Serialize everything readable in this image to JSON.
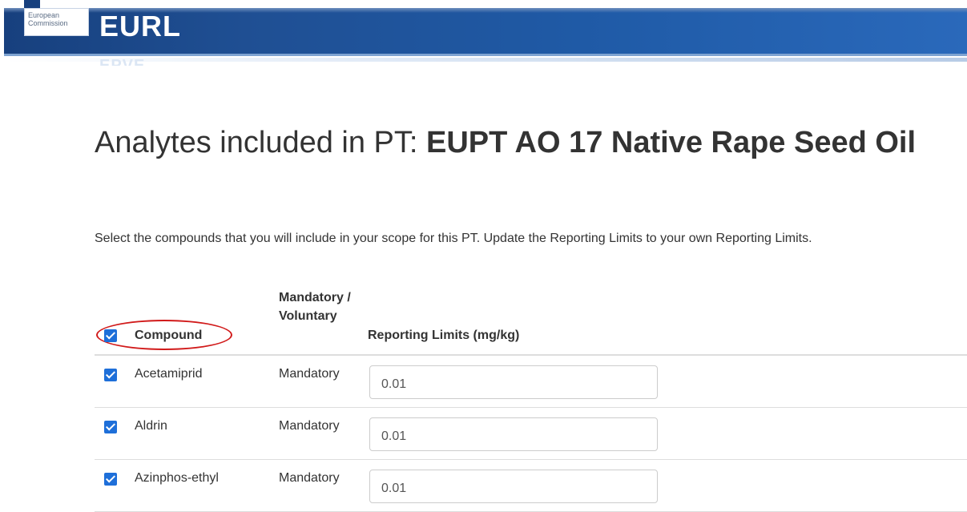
{
  "header": {
    "logo_line1": "European",
    "logo_line2": "Commission",
    "site_name": "EURL",
    "site_sub": "EPVE"
  },
  "page": {
    "title_prefix": "Analytes included in PT: ",
    "title_pt": "EUPT AO 17 Native Rape Seed Oil",
    "intro": "Select the compounds that you will include in your scope for this PT. Update the Reporting Limits to your own Reporting Limits."
  },
  "table": {
    "headers": {
      "compound": "Compound",
      "mandatory": "Mandatory / Voluntary",
      "limits": "Reporting Limits (mg/kg)"
    },
    "select_all_checked": true,
    "rows": [
      {
        "compound": "Acetamiprid",
        "type": "Mandatory",
        "limit": "0.01",
        "checked": true
      },
      {
        "compound": "Aldrin",
        "type": "Mandatory",
        "limit": "0.01",
        "checked": true
      },
      {
        "compound": "Azinphos-ethyl",
        "type": "Mandatory",
        "limit": "0.01",
        "checked": true
      }
    ]
  },
  "colors": {
    "banner": "#1f4f93",
    "checkbox": "#1e6fd9",
    "annotation": "#d11a1a"
  }
}
